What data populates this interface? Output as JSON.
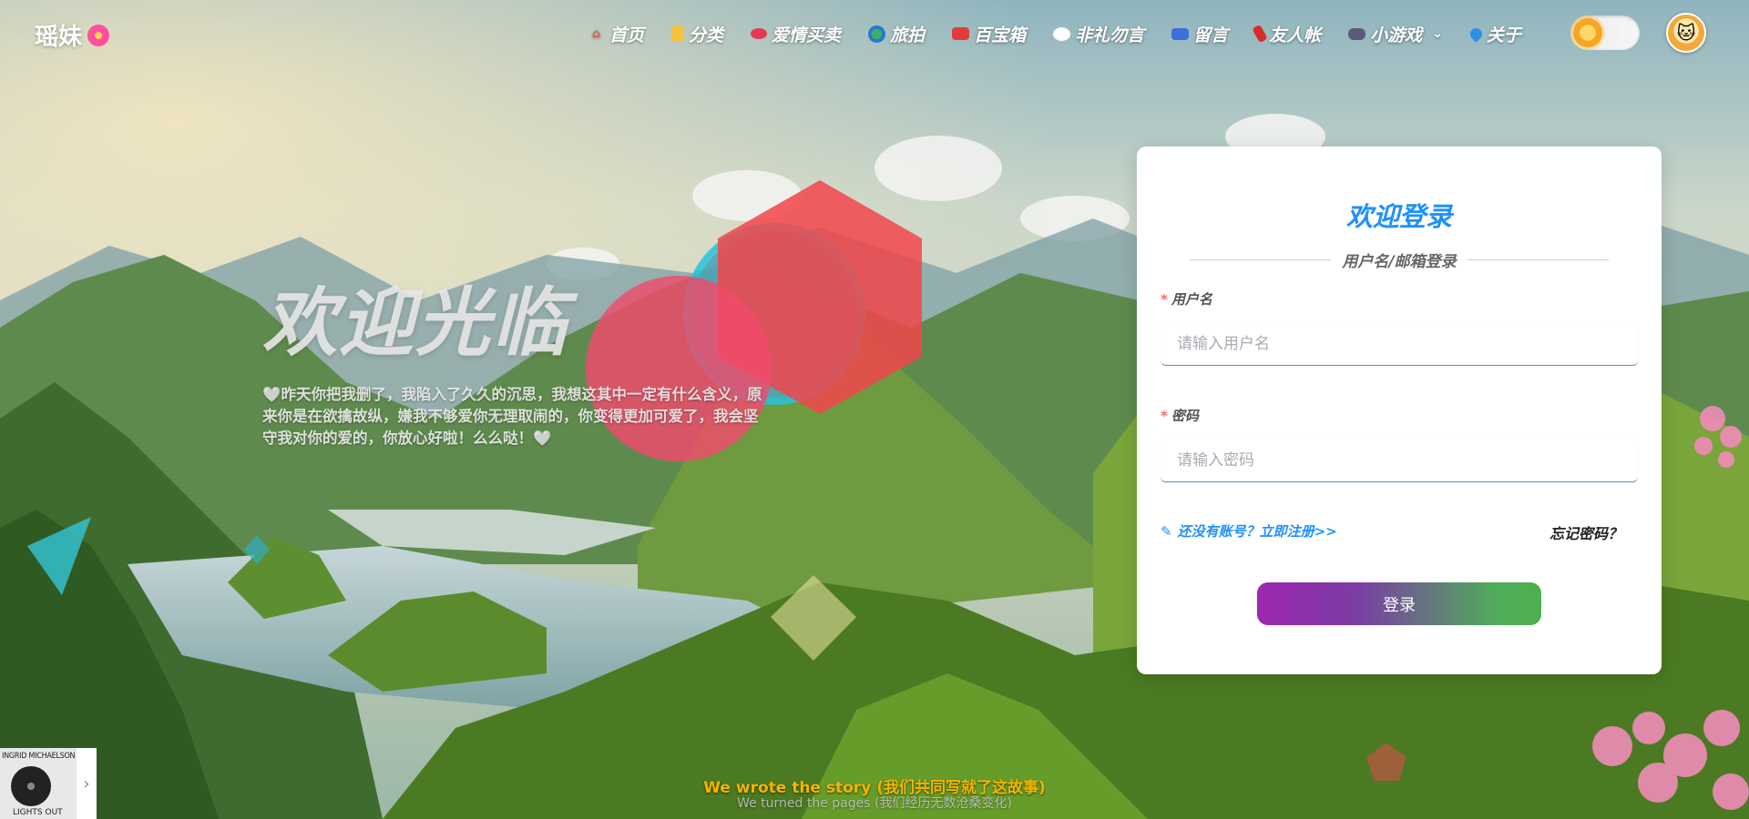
{
  "brand": {
    "name": "瑶妹"
  },
  "nav": {
    "items": [
      {
        "label": "首页",
        "icon": "house-icon"
      },
      {
        "label": "分类",
        "icon": "notebook-icon"
      },
      {
        "label": "爱情买卖",
        "icon": "lips-icon"
      },
      {
        "label": "旅拍",
        "icon": "globe-icon"
      },
      {
        "label": "百宝箱",
        "icon": "toolbox-icon"
      },
      {
        "label": "非礼勿言",
        "icon": "speech-bubble-icon"
      },
      {
        "label": "留言",
        "icon": "mailbox-icon"
      },
      {
        "label": "友人帐",
        "icon": "firecracker-icon"
      },
      {
        "label": "小游戏",
        "icon": "gamepad-icon"
      },
      {
        "label": "关于",
        "icon": "water-drop-icon"
      }
    ],
    "theme_toggle": "light"
  },
  "hero": {
    "title": "欢迎光临",
    "description": "🤍昨天你把我删了，我陷入了久久的沉思，我想这其中一定有什么含义，原来你是在欲擒故纵，嫌我不够爱你无理取闹的，你变得更加可爱了，我会坚守我对你的爱的，你放心好啦！么么哒！🤍"
  },
  "login": {
    "title": "欢迎登录",
    "subtitle": "用户名/邮箱登录",
    "username_label": "用户名",
    "username_placeholder": "请输入用户名",
    "password_label": "密码",
    "password_placeholder": "请输入密码",
    "required_mark": "*",
    "register_link": "还没有账号？立即注册>>",
    "forgot_link": "忘记密码？",
    "submit": "登录"
  },
  "player": {
    "artist": "INGRID MICHAELSON",
    "song": "LIGHTS OUT",
    "next_symbol": "›"
  },
  "lyrics": {
    "line1": "We wrote the story (我们共同写就了这故事)",
    "line2": "We turned the pages (我们经历无数沧桑变化)"
  },
  "colors": {
    "accent": "#1e90ff",
    "required": "#f56c6c",
    "button_start": "#9c27b0",
    "button_end": "#4caf50",
    "lyric": "#f4b400"
  }
}
